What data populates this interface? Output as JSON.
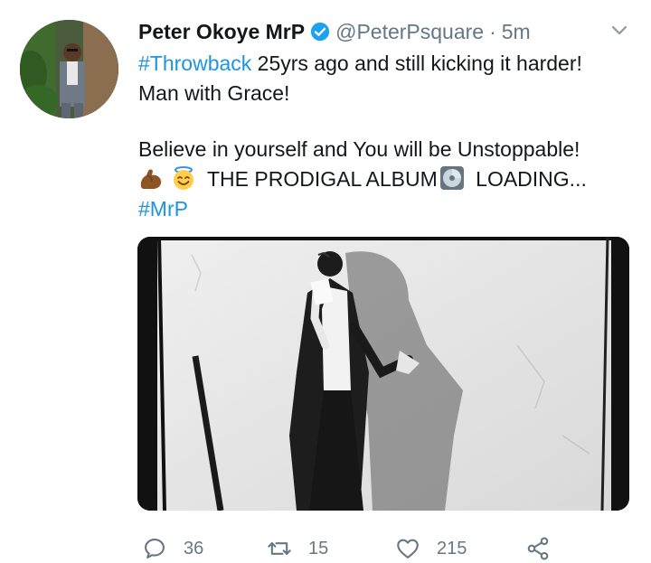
{
  "user": {
    "name": "Peter Okoye MrP",
    "handle": "@PeterPsquare",
    "separator": "·",
    "time": "5m"
  },
  "tweet": {
    "line1_tag": "#Throwback",
    "line1_rest": " 25yrs ago and still kicking it harder!",
    "line2": "Man with Grace!",
    "line3": "Believe in yourself and You will be Unstoppable!",
    "line4_text_a": "THE PRODIGAL ALBUM",
    "line4_text_b": " LOADING...",
    "hashtag": "#MrP",
    "emojis": [
      "flexed-biceps-icon",
      "smiling-face-with-halo-icon",
      "optical-disc-icon"
    ]
  },
  "actions": {
    "reply_count": "36",
    "retweet_count": "15",
    "like_count": "215"
  },
  "colors": {
    "link": "#1b95e0",
    "secondary": "#657786",
    "verified": "#1da1f2"
  }
}
